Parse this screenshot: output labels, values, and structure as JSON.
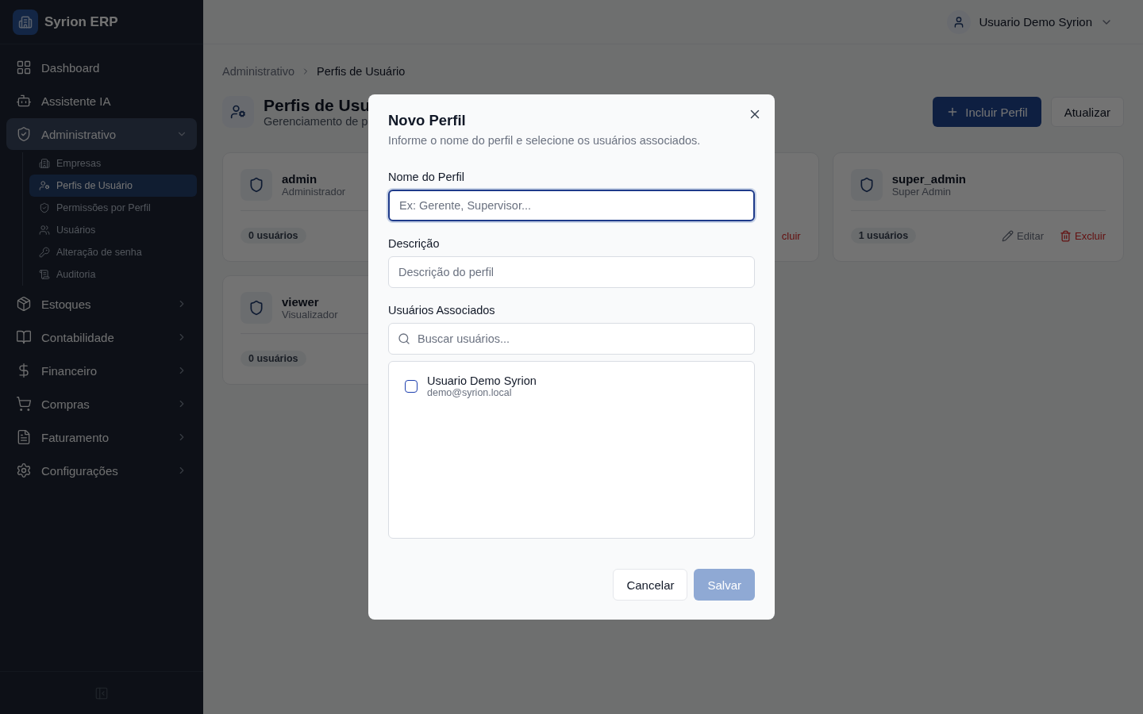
{
  "app": {
    "name": "Syrion ERP"
  },
  "sidebar": {
    "items": [
      {
        "kind": "link",
        "label": "Dashboard"
      },
      {
        "kind": "link",
        "label": "Assistente IA"
      },
      {
        "kind": "group",
        "label": "Administrativo",
        "expanded": true,
        "children": [
          {
            "label": "Empresas",
            "selected": false
          },
          {
            "label": "Perfis de Usuário",
            "selected": true
          },
          {
            "label": "Permissões por Perfil",
            "selected": false
          },
          {
            "label": "Usuários",
            "selected": false
          },
          {
            "label": "Alteração de senha",
            "selected": false
          },
          {
            "label": "Auditoria",
            "selected": false
          }
        ]
      },
      {
        "kind": "group",
        "label": "Estoques",
        "expanded": false
      },
      {
        "kind": "group",
        "label": "Contabilidade",
        "expanded": false
      },
      {
        "kind": "group",
        "label": "Financeiro",
        "expanded": false
      },
      {
        "kind": "group",
        "label": "Compras",
        "expanded": false
      },
      {
        "kind": "group",
        "label": "Faturamento",
        "expanded": false
      },
      {
        "kind": "group",
        "label": "Configurações",
        "expanded": false
      }
    ]
  },
  "topbar": {
    "user": "Usuario Demo Syrion"
  },
  "breadcrumb": [
    "Administrativo",
    "Perfis de Usuário"
  ],
  "page": {
    "title": "Perfis de Usu",
    "subtitle": "Gerenciamento de p",
    "buttons": [
      {
        "kind": "primary",
        "label": "Incluir Perfil"
      },
      {
        "kind": "secondary",
        "label": "Atualizar"
      }
    ]
  },
  "cards": [
    {
      "name": "admin",
      "description": "Administrador",
      "count": "0 usuários"
    },
    {
      "delete": "cluir"
    },
    {
      "name": "super_admin",
      "description": "Super Admin",
      "count": "1 usuários",
      "edit": "Editar",
      "delete": "Excluir"
    },
    {
      "name": "viewer",
      "description": "Visualizador",
      "count": "0 usuários"
    }
  ],
  "dialog": {
    "title": "Novo Perfil",
    "description": "Informe o nome do perfil e selecione os usuários associados.",
    "fields": [
      {
        "label": "Nome do Perfil",
        "placeholder": "Ex: Gerente, Supervisor...",
        "focused": true
      },
      {
        "label": "Descrição",
        "placeholder": "Descrição do perfil",
        "focused": false
      }
    ],
    "users_label": "Usuários Associados",
    "search_placeholder": "Buscar usuários...",
    "users": [
      {
        "name": "Usuario Demo Syrion",
        "email": "demo@syrion.local",
        "checked": false
      }
    ],
    "buttons": [
      {
        "kind": "secondary",
        "label": "Cancelar",
        "disabled": false
      },
      {
        "kind": "primary",
        "label": "Salvar",
        "disabled": true
      }
    ]
  }
}
